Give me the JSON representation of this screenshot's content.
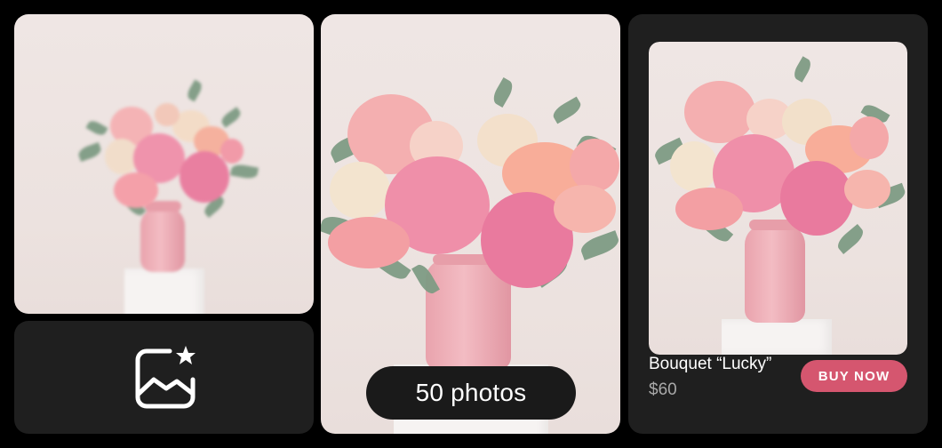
{
  "gallery": {
    "photo_count_label": "50 photos",
    "icon": "image-sparkle-icon"
  },
  "product": {
    "name": "Bouquet “Lucky”",
    "price": "$60",
    "buy_label": "BUY NOW"
  },
  "colors": {
    "page_background": "#000000",
    "card_dark": "#1f1f1f",
    "pill_background": "#1a1a1a",
    "accent_button": "#d5566f",
    "price_text": "#a9a9a9",
    "photo_background": "#ede4e2",
    "vase_pink": "#efaab3"
  }
}
